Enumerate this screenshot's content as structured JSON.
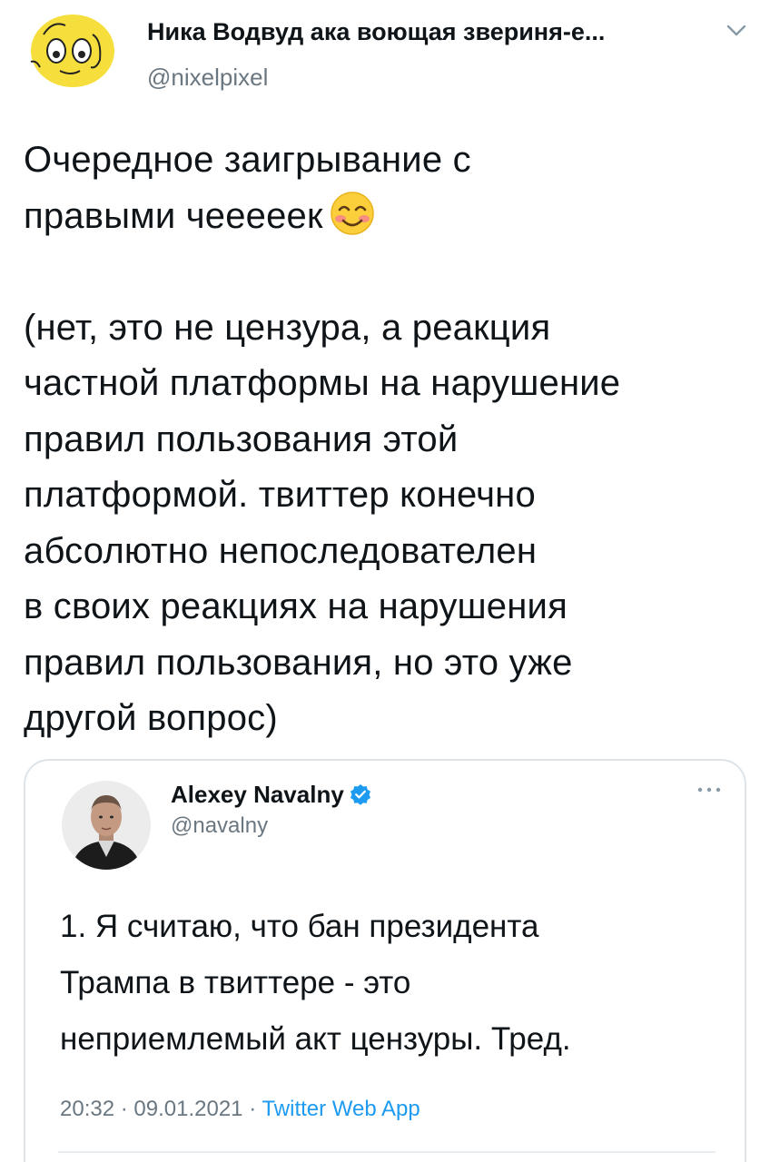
{
  "tweet": {
    "author_name": "Ника Водвуд ака воющая звериня-е...",
    "author_handle": "@nixelpixel",
    "text_part1": "Очередное заигрывание с\nправыми чееееек",
    "emoji": "smiling-face-with-smiling-eyes",
    "text_part2": "(нет, это не цензура, а реакция\nчастной платформы на нарушение\nправил пользования этой\nплатформой. твиттер конечно\nабсолютно непоследователен\nв своих реакциях на нарушения\nправил пользования, но это уже\nдругой вопрос)"
  },
  "quoted_tweet": {
    "author_name": "Alexey Navalny",
    "author_handle": "@navalny",
    "text": "1. Я считаю, что бан президента\nТрампа в твиттере - это\nнеприемлемый акт цензуры. Тред.",
    "time": "20:32",
    "date": "09.01.2021",
    "separator": "·",
    "source": "Twitter Web App"
  },
  "colors": {
    "text": "#0f1419",
    "muted": "#6b7780",
    "accent": "#1d9bf0",
    "card_border": "#dde3e7",
    "avatar_yellow": "#f6df3c"
  }
}
